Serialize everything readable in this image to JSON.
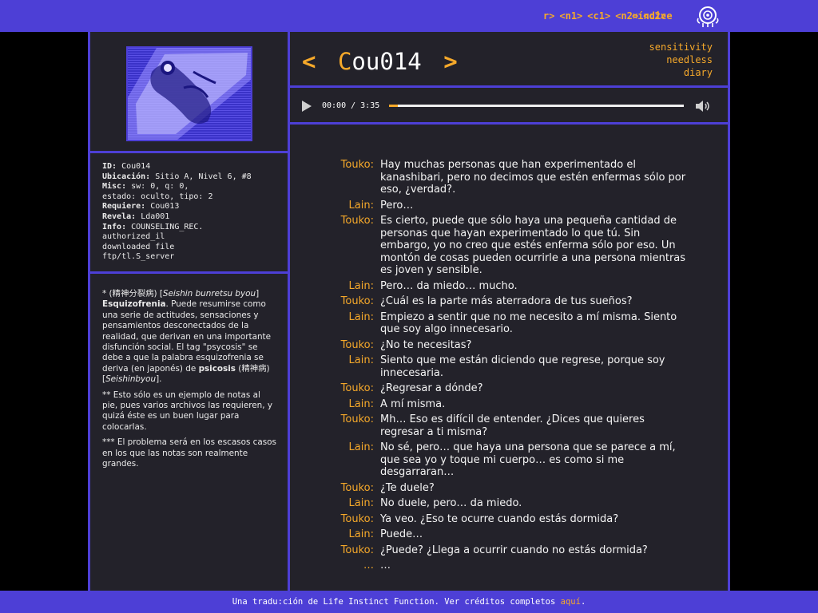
{
  "nav": {
    "items": [
      "r>",
      "<n1>",
      "<c1>",
      "<n2>",
      "<c2>"
    ],
    "index": "<índice"
  },
  "title": {
    "prev": "<",
    "first_letter": "C",
    "rest": "ou014",
    "next": ">"
  },
  "tags": [
    "sensitivity",
    "needless",
    "diary"
  ],
  "player": {
    "time": "00:00 / 3:35",
    "progress": 0.03
  },
  "info": {
    "id_label": "ID:",
    "id": "Cou014",
    "ubicacion_label": "Ubicación:",
    "ubicacion": "Sitio A, Nivel 6, #8",
    "misc_label": "Misc:",
    "misc": "sw: 0, q: 0,",
    "misc2": "estado: oculto, tipo: 2",
    "requiere_label": "Requiere:",
    "requiere": "Cou013",
    "revela_label": "Revela:",
    "revela": "Lda001",
    "info_label": "Info:",
    "info": "COUNSELING_REC.",
    "extra1": "authorized_il",
    "extra2": "downloaded file",
    "extra3": "ftp/tl.S_server"
  },
  "notes": {
    "n1_prefix": "* (精神分裂病) [",
    "n1_italic": "Seishin bunretsu byou",
    "n1_close": "]",
    "n1_bold": "Esquizofrenia",
    "n1_text": ". Puede resumirse como una serie de actitudes, sensaciones y pensamientos desconectados de la realidad, que derivan en una importante disfunción social. El tag \"psycosis\" se debe a que la palabra esquizofrenia se deriva (en japonés) de ",
    "n1_bold2": "psicosis",
    "n1_text2": " (精神病) [",
    "n1_italic2": "Seishinbyou",
    "n1_end": "].",
    "n2": "** Esto sólo es un ejemplo de notas al pie, pues varios archivos las requieren, y quizá éste es un buen lugar para colocarlas.",
    "n3": "*** El problema será en los escasos casos en los que las notas son realmente grandes."
  },
  "dialog": [
    {
      "speaker": "Touko:",
      "text": "Hay muchas personas que han experimentado el kanashibari, pero no decimos que estén enfermas sólo por eso, ¿verdad?."
    },
    {
      "speaker": "Lain:",
      "text": "Pero…"
    },
    {
      "speaker": "Touko:",
      "text": "Es cierto, puede que sólo haya una pequeña cantidad de personas que hayan experimentado lo que tú. Sin embargo, yo no creo que estés enferma sólo por eso. Un montón de cosas pueden ocurrirle a una persona mientras es joven y sensible."
    },
    {
      "speaker": "Lain:",
      "text": "Pero… da miedo… mucho."
    },
    {
      "speaker": "Touko:",
      "text": "¿Cuál es la parte más aterradora de tus sueños?"
    },
    {
      "speaker": "Lain:",
      "text": "Empiezo a sentir que no me necesito a mí misma. Siento que soy algo innecesario."
    },
    {
      "speaker": "Touko:",
      "text": "¿No te necesitas?"
    },
    {
      "speaker": "Lain:",
      "text": "Siento que me están diciendo que regrese, porque soy innecesaria."
    },
    {
      "speaker": "Touko:",
      "text": "¿Regresar a dónde?"
    },
    {
      "speaker": "Lain:",
      "text": "A mí misma."
    },
    {
      "speaker": "Touko:",
      "text": "Mh… Eso es difícil de entender. ¿Dices que quieres regresar a ti misma?"
    },
    {
      "speaker": "Lain:",
      "text": "No sé, pero… que haya una persona que se parece a mí, que sea yo y toque mi cuerpo… es como si me desgarraran…"
    },
    {
      "speaker": "Touko:",
      "text": "¿Te duele?"
    },
    {
      "speaker": "Lain:",
      "text": "No duele, pero… da miedo."
    },
    {
      "speaker": "Touko:",
      "text": "Ya veo. ¿Eso te ocurre cuando estás dormida?"
    },
    {
      "speaker": "Lain:",
      "text": "Puede…"
    },
    {
      "speaker": "Touko:",
      "text": "¿Puede? ¿Llega a ocurrir cuando no estás dormida?"
    },
    {
      "speaker": "…",
      "text": "…"
    }
  ],
  "footer": {
    "text": "Una tradu:ción de Life Instinct Function. Ver créditos completos ",
    "link": "aquí",
    "end": "."
  },
  "colors": {
    "accent": "#f6a92a",
    "brand": "#4d3fd6",
    "panel": "#23222a"
  }
}
